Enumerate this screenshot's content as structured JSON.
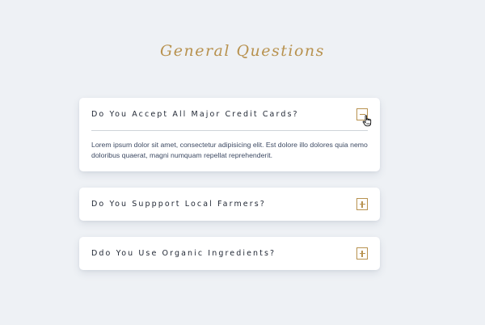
{
  "page": {
    "title": "General Questions"
  },
  "faq": {
    "items": [
      {
        "question": "Do You Accept All Major Credit Cards?",
        "answer": "Lorem ipsum dolor sit amet, consectetur adipisicing elit. Est dolore illo dolores quia nemo doloribus quaerat, magni numquam repellat reprehenderit.",
        "expanded": true,
        "toggle_icon": "minus-icon"
      },
      {
        "question": "Do You Suppport Local Farmers?",
        "expanded": false,
        "toggle_icon": "plus-icon"
      },
      {
        "question": "Ddo You Use Organic Ingredients?",
        "expanded": false,
        "toggle_icon": "plus-icon"
      }
    ]
  },
  "colors": {
    "background": "#eef1f5",
    "accent": "#b8924f",
    "question_text": "#1f2633",
    "answer_text": "#3d4a63",
    "card": "#ffffff"
  }
}
